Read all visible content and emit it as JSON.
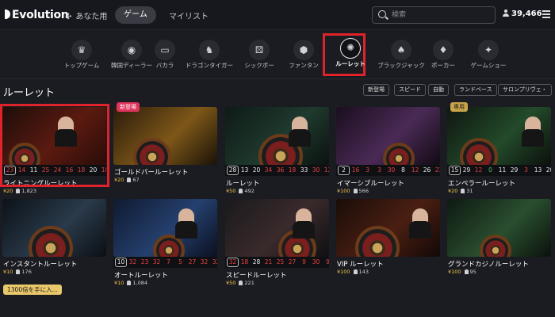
{
  "header": {
    "logo": "Evolution",
    "nav_foryou": "あなた用",
    "nav_game": "ゲーム",
    "nav_mylist": "マイリスト",
    "search_placeholder": "検索",
    "balance": "39,466"
  },
  "categories": [
    {
      "label": "トップゲーム",
      "icon": "trophy-icon",
      "glyph": "♛"
    },
    {
      "label": "韓国ディーラー",
      "icon": "chip-icon",
      "glyph": "◉"
    },
    {
      "label": "バカラ",
      "icon": "cards-icon",
      "glyph": "▭"
    },
    {
      "label": "ドラゴンタイガー",
      "icon": "dragon-icon",
      "glyph": "♞"
    },
    {
      "label": "シックボー",
      "icon": "dice-icon",
      "glyph": "⚄"
    },
    {
      "label": "ファンタン",
      "icon": "fantan-icon",
      "glyph": "⬢"
    },
    {
      "label": "ルーレット",
      "icon": "roulette-icon",
      "glyph": "✺"
    },
    {
      "label": "ブラックジャック",
      "icon": "blackjack-icon",
      "glyph": "♠"
    },
    {
      "label": "ポーカー",
      "icon": "poker-icon",
      "glyph": "♦"
    },
    {
      "label": "ゲームショー",
      "icon": "gameshow-icon",
      "glyph": "✦"
    }
  ],
  "section": {
    "title": "ルーレット",
    "filters": [
      "新登場",
      "スピード",
      "自動",
      "ランドベース",
      "サロンプリヴェ・"
    ]
  },
  "tiles": [
    {
      "name": "ライトニングルーレット",
      "limit": "¥20",
      "players": "1,823",
      "numbers": [
        "23",
        "14",
        "11",
        "25",
        "24",
        "16",
        "18",
        "20",
        "18"
      ],
      "colors": [
        "r",
        "r",
        "w",
        "r",
        "r",
        "r",
        "r",
        "w",
        "r"
      ],
      "badge": ""
    },
    {
      "name": "ゴールドバールーレット",
      "limit": "¥20",
      "players": "67",
      "numbers": [],
      "colors": [],
      "badge": "新登場"
    },
    {
      "name": "ルーレット",
      "limit": "¥50",
      "players": "492",
      "numbers": [
        "28",
        "13",
        "20",
        "34",
        "36",
        "18",
        "33",
        "30",
        "12"
      ],
      "colors": [
        "w",
        "w",
        "w",
        "r",
        "r",
        "r",
        "w",
        "r",
        "r"
      ],
      "badge": ""
    },
    {
      "name": "イマーシブルーレット",
      "limit": "¥100",
      "players": "566",
      "numbers": [
        "2",
        "16",
        "3",
        "3",
        "30",
        "8",
        "12",
        "26",
        "23"
      ],
      "colors": [
        "w",
        "r",
        "r",
        "r",
        "r",
        "w",
        "r",
        "w",
        "r"
      ],
      "badge": ""
    },
    {
      "name": "エンペラールーレット",
      "limit": "¥20",
      "players": "31",
      "numbers": [
        "15",
        "29",
        "12",
        "0",
        "11",
        "29",
        "3",
        "13",
        "20"
      ],
      "colors": [
        "w",
        "w",
        "r",
        "g",
        "w",
        "w",
        "r",
        "w",
        "w"
      ],
      "badge": "専用"
    },
    {
      "name": "インスタントルーレット",
      "limit": "¥10",
      "players": "176",
      "numbers": [],
      "colors": [],
      "badge": ""
    },
    {
      "name": "オートルーレット",
      "limit": "¥10",
      "players": "1,084",
      "numbers": [
        "10",
        "32",
        "23",
        "32",
        "7",
        "5",
        "27",
        "32",
        "32"
      ],
      "colors": [
        "w",
        "r",
        "r",
        "r",
        "r",
        "r",
        "r",
        "r",
        "r"
      ],
      "badge": ""
    },
    {
      "name": "スピードルーレット",
      "limit": "¥50",
      "players": "221",
      "numbers": [
        "32",
        "18",
        "28",
        "21",
        "25",
        "27",
        "9",
        "30",
        "9"
      ],
      "colors": [
        "r",
        "r",
        "w",
        "r",
        "r",
        "r",
        "r",
        "r",
        "r"
      ],
      "badge": ""
    },
    {
      "name": "VIP ルーレット",
      "limit": "¥100",
      "players": "143",
      "numbers": [],
      "colors": [],
      "badge": ""
    },
    {
      "name": "グランドカジノルーレット",
      "limit": "¥100",
      "players": "95",
      "numbers": [],
      "colors": [],
      "badge": ""
    }
  ],
  "promo": "1300倍を手に入..."
}
